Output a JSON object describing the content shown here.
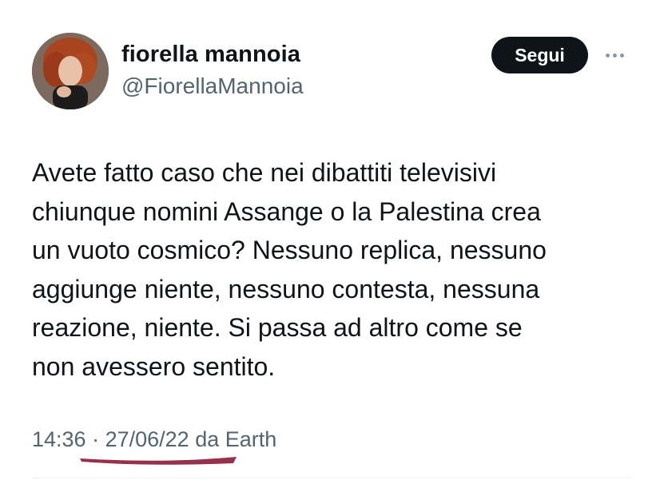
{
  "header": {
    "display_name": "fiorella mannoia",
    "handle": "@FiorellaMannoia",
    "follow_label": "Segui",
    "more_icon": "more-icon",
    "avatar_icon": "avatar"
  },
  "tweet": {
    "text": "Avete fatto caso che nei dibattiti televisivi\nchiunque nomini Assange o la Palestina crea\nun vuoto cosmico? Nessuno replica, nessuno\naggiunge niente, nessuno contesta, nessuna\nreazione, niente. Si passa ad altro come se\nnon avessero sentito."
  },
  "meta": {
    "time": "14:36",
    "separator": " · ",
    "date": "27/06/22",
    "source": " da Earth"
  },
  "colors": {
    "text": "#0f1419",
    "secondary": "#536471",
    "follow_bg": "#0f1419",
    "annotation_underline": "#8b1a3a"
  }
}
